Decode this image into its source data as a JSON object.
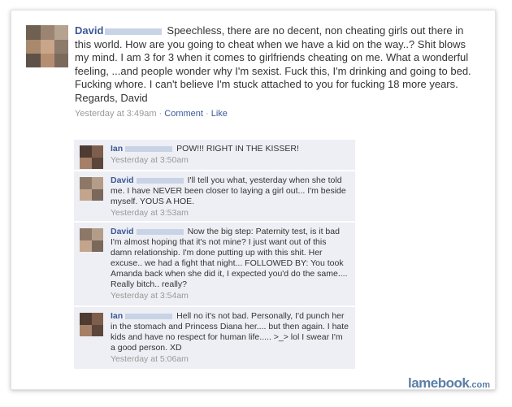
{
  "post": {
    "author": "David",
    "text": "Speechless, there are no decent, non cheating girls out there in this world. How are you going to cheat when we have a kid on the way..? Shit blows my mind. I am 3 for 3 when it comes to girlfriends cheating on me. What a wonderful feeling, ...and people wonder why I'm sexist. Fuck this, I'm drinking and going to bed. Fucking whore. I can't believe I'm stuck attached to you for fucking 18 more years. Regards, David",
    "timestamp": "Yesterday at 3:49am",
    "separator": " · ",
    "comment_link": "Comment",
    "like_link": "Like"
  },
  "comments": [
    {
      "author": "Ian",
      "text": "POW!!! RIGHT IN THE KISSER!",
      "timestamp": "Yesterday at 3:50am"
    },
    {
      "author": "David",
      "text": "I'll tell you what, yesterday when she told me. I have NEVER been closer to laying a girl out... I'm beside myself. YOUS A HOE.",
      "timestamp": "Yesterday at 3:53am"
    },
    {
      "author": "David",
      "text": "Now the big step: Paternity test, is it bad I'm almost hoping that it's not mine? I just want out of this damn relationship. I'm done putting up with this shit. Her excuse.. we had a fight that night... FOLLOWED BY: You took Amanda back when she did it, I expected you'd do the same.... Really bitch.. really?",
      "timestamp": "Yesterday at 3:54am"
    },
    {
      "author": "Ian",
      "text": "Hell no it's not bad. Personally, I'd punch her in the stomach and Princess Diana her.... but then again. I hate kids and have no respect for human life..... >_> lol I swear I'm a good person. XD",
      "timestamp": "Yesterday at 5:06am"
    }
  ],
  "watermark": {
    "brand": "lamebook",
    "suffix": ".com"
  }
}
